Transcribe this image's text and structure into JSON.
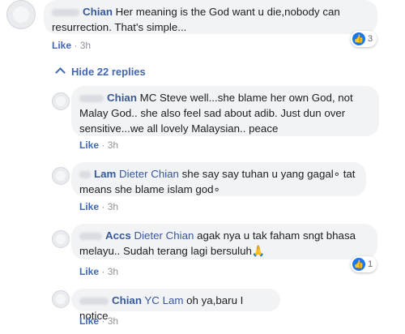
{
  "comment": {
    "author": "Chian",
    "text": "Her meaning is the God want u die,nobody can resurrection. That's simple...",
    "like_label": "Like",
    "separator": "·",
    "time": "3h",
    "reaction_count": "3"
  },
  "toggle": {
    "label": "Hide 22 replies"
  },
  "replies": [
    {
      "author": "Chian",
      "text": "MC Steve well...she blame her own God, not Malay God.. she also feel sad about adib. Just dun over sensitive...we all lovely Malaysian.. peace",
      "like_label": "Like",
      "separator": "·",
      "time": "3h"
    },
    {
      "author": "Lam",
      "tag": "Dieter Chian",
      "text": "she say say tuhan u yang gagal∘ tat means she blame islam god∘",
      "like_label": "Like",
      "separator": "·",
      "time": "3h"
    },
    {
      "author": "Accs",
      "tag": "Dieter Chian",
      "text": "agak nya u tak faham sngt bhasa melayu.. Sudah terang lagi bersuluh🙏",
      "like_label": "Like",
      "separator": "·",
      "time": "3h",
      "reaction_count": "1"
    },
    {
      "author": "Chian",
      "tag": "YC Lam",
      "text": "oh ya,baru I notice",
      "like_label": "Like",
      "separator": "·",
      "time": "3h"
    }
  ],
  "colors": {
    "link": "#385898",
    "bubble": "#f2f3f5",
    "like_blue": "#1877f2"
  }
}
